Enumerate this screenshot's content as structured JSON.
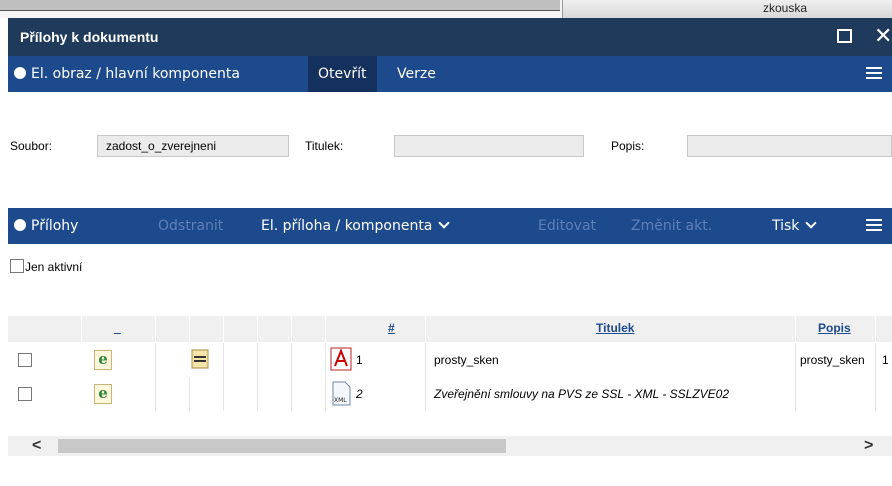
{
  "background": {
    "top_right_text": "zkouska"
  },
  "dialog": {
    "title": "Přílohy k dokumentu",
    "maximize_icon": "square-icon",
    "close_icon": "close-icon"
  },
  "main_section": {
    "title": "El. obraz / hlavní komponenta",
    "actions": [
      {
        "label": "Otevřít"
      },
      {
        "label": "Verze"
      }
    ]
  },
  "form": {
    "file_label": "Soubor:",
    "file_value": "zadost_o_zverejneni",
    "title_label": "Titulek:",
    "title_value": "",
    "description_label": "Popis:",
    "description_value": ""
  },
  "attachments_section": {
    "title": "Přílohy",
    "actions": [
      {
        "label": "Odstranit",
        "enabled": false
      },
      {
        "label": "El. příloha / komponenta",
        "enabled": true
      },
      {
        "label": "Editovat",
        "enabled": false
      },
      {
        "label": "Změnit akt.",
        "enabled": false
      },
      {
        "label": "Tisk",
        "enabled": true
      }
    ],
    "only_active_label": "Jen aktivní",
    "only_active_checked": false
  },
  "table": {
    "headers": {
      "col1": "_",
      "num": "#",
      "title": "Titulek",
      "description": "Popis"
    },
    "rows": [
      {
        "checked": false,
        "type_icon": "edge-document-icon",
        "extra_icon": "text-file-icon",
        "file_icon": "pdf-icon",
        "num": "1",
        "title": "prosty_sken",
        "description": "prosty_sken",
        "extra": "1"
      },
      {
        "checked": false,
        "type_icon": "edge-document-icon",
        "extra_icon": "",
        "file_icon": "xml-file-icon",
        "num": "2",
        "title": "Zveřejnění smlouvy na PVS ze SSL - XML - SSLZVE02",
        "description": "",
        "extra": ""
      }
    ]
  },
  "scrollbar": {
    "left_arrow": "<",
    "right_arrow": ">"
  },
  "colors": {
    "titlebar": "#1f3a5b",
    "band": "#1d4a8c",
    "disabled_action": "#5f7fb8",
    "header_link": "#1d4a8c"
  }
}
